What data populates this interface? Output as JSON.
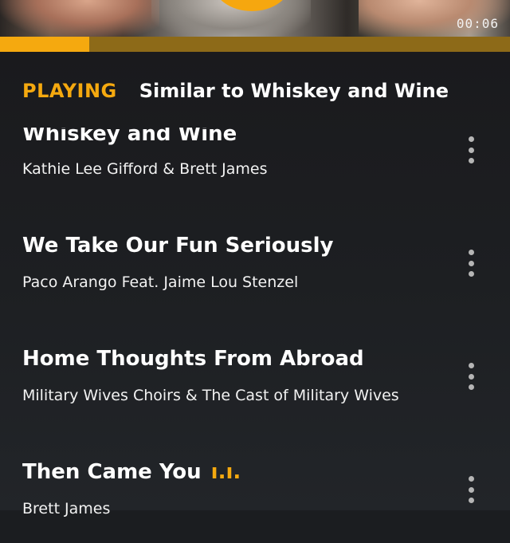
{
  "player": {
    "time": "00:06",
    "progress_fraction": 0.175,
    "accent_color": "#f5a90f"
  },
  "tabs": {
    "playing": "PLAYING",
    "similar": "Similar to Whiskey and Wine"
  },
  "songs": [
    {
      "title": "Whiskey and Wine",
      "artist": "Kathie Lee Gifford & Brett James",
      "playing": false
    },
    {
      "title": "We Take Our Fun Seriously",
      "artist": "Paco Arango Feat. Jaime Lou Stenzel",
      "playing": false
    },
    {
      "title": "Home Thoughts From Abroad",
      "artist": "Military Wives Choirs & The Cast of Military Wives",
      "playing": false
    },
    {
      "title": "Then Came You",
      "artist": "Brett James",
      "playing": true,
      "eq_glyph": "ı.ı."
    }
  ]
}
